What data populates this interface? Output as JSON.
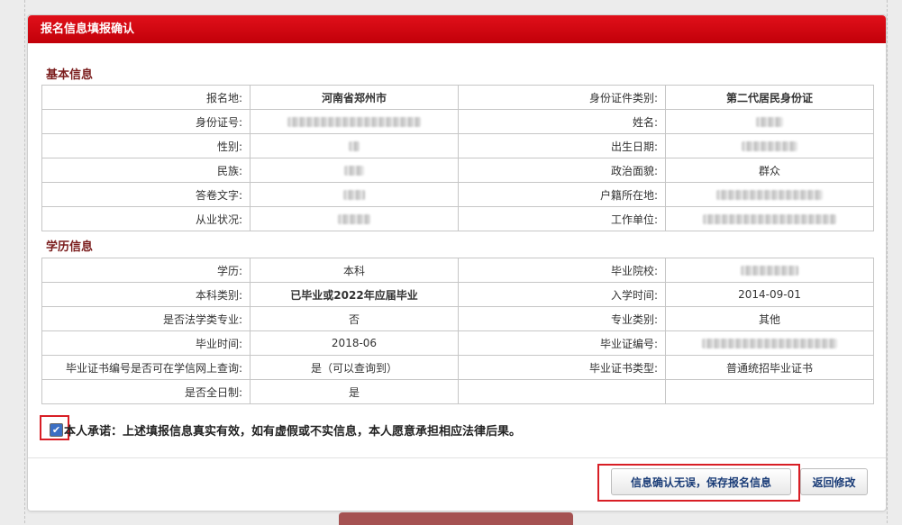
{
  "panel_title": "报名信息填报确认",
  "basic": {
    "title": "基本信息",
    "rows": [
      [
        "报名地:",
        "河南省郑州市",
        "身份证件类别:",
        "第二代居民身份证"
      ],
      [
        "身份证号:",
        "",
        "姓名:",
        ""
      ],
      [
        "性别:",
        "",
        "出生日期:",
        ""
      ],
      [
        "民族:",
        "",
        "政治面貌:",
        "群众"
      ],
      [
        "答卷文字:",
        "",
        "户籍所在地:",
        ""
      ],
      [
        "从业状况:",
        "",
        "工作单位:",
        ""
      ]
    ]
  },
  "edu": {
    "title": "学历信息",
    "rows": [
      [
        "学历:",
        "本科",
        "毕业院校:",
        ""
      ],
      [
        "本科类别:",
        "已毕业或2022年应届毕业",
        "入学时间:",
        "2014-09-01"
      ],
      [
        "是否法学类专业:",
        "否",
        "专业类别:",
        "其他"
      ],
      [
        "毕业时间:",
        "2018-06",
        "毕业证编号:",
        ""
      ],
      [
        "毕业证书编号是否可在学信网上查询:",
        "是（可以查询到）",
        "毕业证书类型:",
        "普通统招毕业证书"
      ],
      [
        "是否全日制:",
        "是",
        "",
        ""
      ]
    ]
  },
  "pledge_text": "本人承诺：上述填报信息真实有效，如有虚假或不实信息，本人愿意承担相应法律后果。",
  "buttons": {
    "save": "信息确认无误，保存报名信息",
    "back": "返回修改"
  },
  "colors": {
    "header": "#d0000f",
    "highlight": "#d81e25",
    "section_title": "#7a1c1c"
  }
}
